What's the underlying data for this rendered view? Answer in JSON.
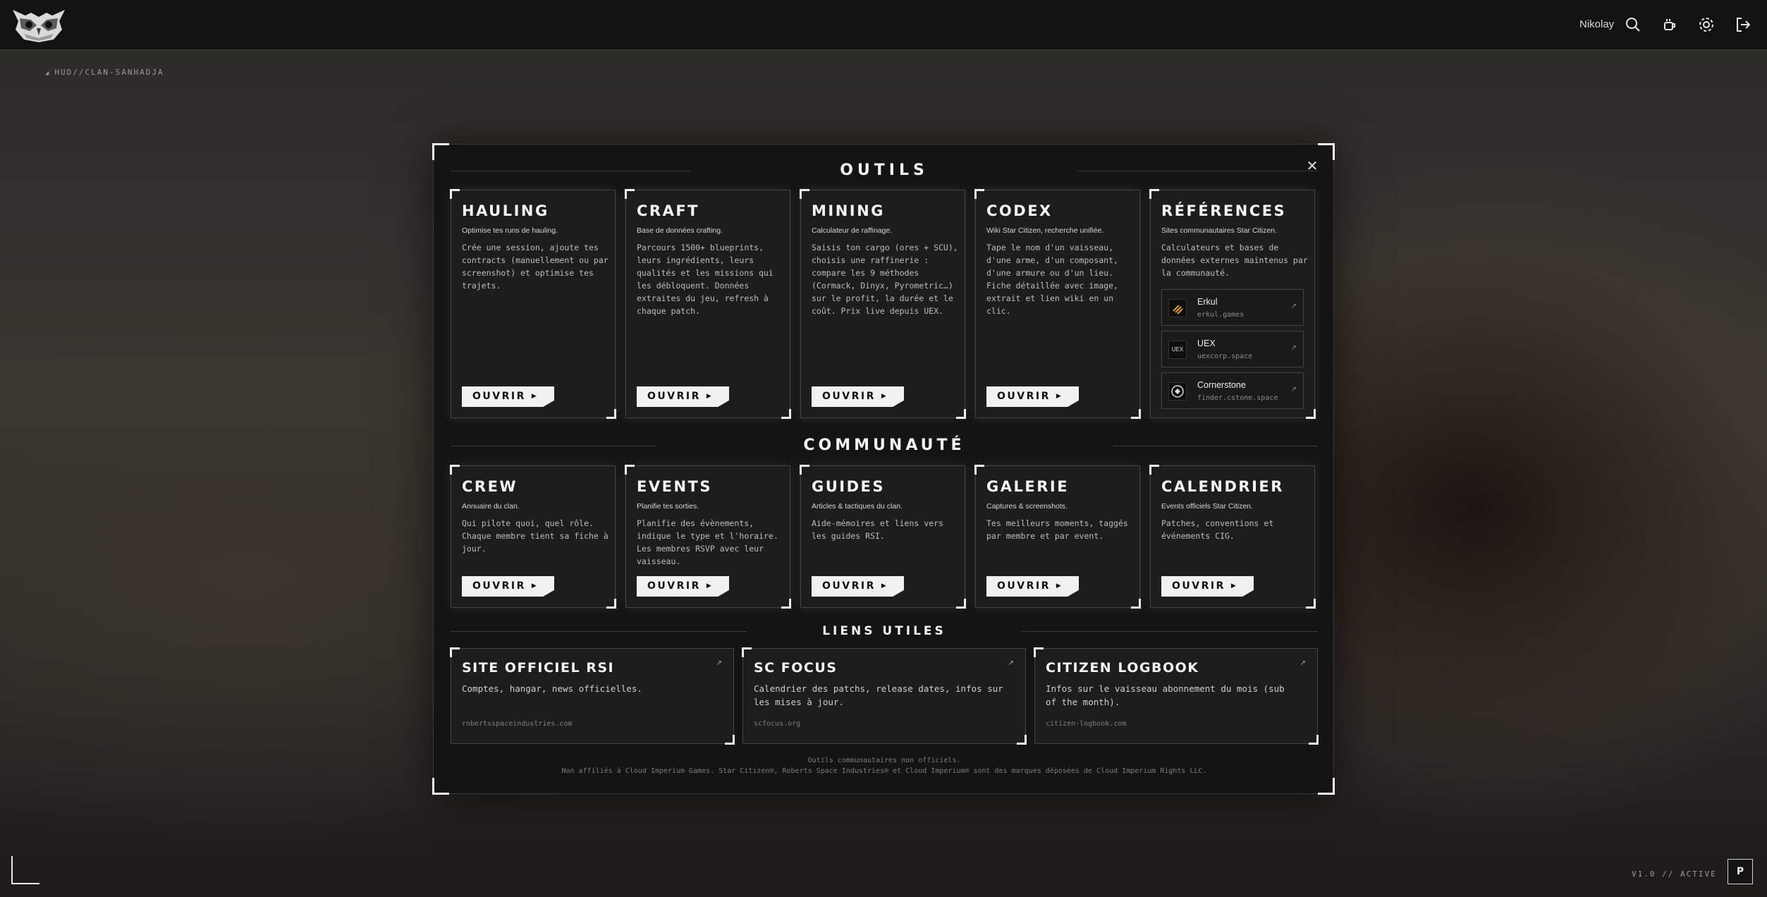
{
  "topbar": {
    "user_name": "Nikolay",
    "icons": [
      "search-icon",
      "coffee-icon",
      "gear-icon",
      "logout-icon"
    ]
  },
  "breadcrumb": "HUD//CLAN-SANHADJA",
  "modal": {
    "close_label": "✕",
    "sections": {
      "tools_title": "OUTILS",
      "community_title": "COMMUNAUTÉ",
      "links_title": "LIENS UTILES"
    },
    "tools": [
      {
        "title": "HAULING",
        "subtitle": "Optimise tes runs de hauling.",
        "desc": "Crée une session, ajoute tes contracts (manuellement ou par screenshot) et optimise tes trajets.",
        "button": "OUVRIR"
      },
      {
        "title": "CRAFT",
        "subtitle": "Base de données crafting.",
        "desc": "Parcours 1500+ blueprints, leurs ingrédients, leurs qualités et les missions qui les débloquent. Données extraites du jeu, refresh à chaque patch.",
        "button": "OUVRIR"
      },
      {
        "title": "MINING",
        "subtitle": "Calculateur de raffinage.",
        "desc": "Saisis ton cargo (ores + SCU), choisis une raffinerie : compare les 9 méthodes (Cormack, Dinyx, Pyrometric…) sur le profit, la durée et le coût. Prix live depuis UEX.",
        "button": "OUVRIR"
      },
      {
        "title": "CODEX",
        "subtitle": "Wiki Star Citizen, recherche unifiée.",
        "desc": "Tape le nom d'un vaisseau, d'une arme, d'un composant, d'une armure ou d'un lieu. Fiche détaillée avec image, extrait et lien wiki en un clic.",
        "button": "OUVRIR"
      }
    ],
    "references": {
      "title": "RÉFÉRENCES",
      "subtitle": "Sites communautaires Star Citizen.",
      "desc": "Calculateurs et bases de données externes maintenus par la communauté.",
      "items": [
        {
          "name": "Erkul",
          "url": "erkul.games",
          "icon": "erkul-logo-icon",
          "icon_text": ""
        },
        {
          "name": "UEX",
          "url": "uexcorp.space",
          "icon": "uex-logo-icon",
          "icon_text": "UEX"
        },
        {
          "name": "Cornerstone",
          "url": "finder.cstone.space",
          "icon": "cornerstone-logo-icon",
          "icon_text": ""
        }
      ],
      "external_arrow": "↗"
    },
    "community": [
      {
        "title": "CREW",
        "subtitle": "Annuaire du clan.",
        "desc": "Qui pilote quoi, quel rôle. Chaque membre tient sa fiche à jour.",
        "button": "OUVRIR"
      },
      {
        "title": "EVENTS",
        "subtitle": "Planifie tes sorties.",
        "desc": "Planifie des évènements, indique le type et l'horaire. Les membres RSVP avec leur vaisseau.",
        "button": "OUVRIR"
      },
      {
        "title": "GUIDES",
        "subtitle": "Articles & tactiques du clan.",
        "desc": "Aide-mémoires et liens vers les guides RSI.",
        "button": "OUVRIR"
      },
      {
        "title": "GALERIE",
        "subtitle": "Captures & screenshots.",
        "desc": "Tes meilleurs moments, taggés par membre et par event.",
        "button": "OUVRIR"
      },
      {
        "title": "CALENDRIER",
        "subtitle": "Events officiels Star Citizen.",
        "desc": "Patches, conventions et événements CIG.",
        "button": "OUVRIR"
      }
    ],
    "links": [
      {
        "title": "SITE OFFICIEL RSI",
        "desc": "Comptes, hangar, news officielles.",
        "url": "robertsspaceindustries.com"
      },
      {
        "title": "SC FOCUS",
        "desc": "Calendrier des patchs, release dates, infos sur les mises à jour.",
        "url": "scfocus.org"
      },
      {
        "title": "CITIZEN LOGBOOK",
        "desc": "Infos sur le vaisseau abonnement du mois (sub of the month).",
        "url": "citizen-logbook.com"
      }
    ],
    "disclaimer_line1": "Outils communautaires non officiels.",
    "disclaimer_line2": "Non affiliés à Cloud Imperium Games. Star Citizen®, Roberts Space Industries® et Cloud Imperium® sont des marques déposées de Cloud Imperium Rights LLC."
  },
  "status": "V1.0 // ACTIVE",
  "flag_button": "P"
}
